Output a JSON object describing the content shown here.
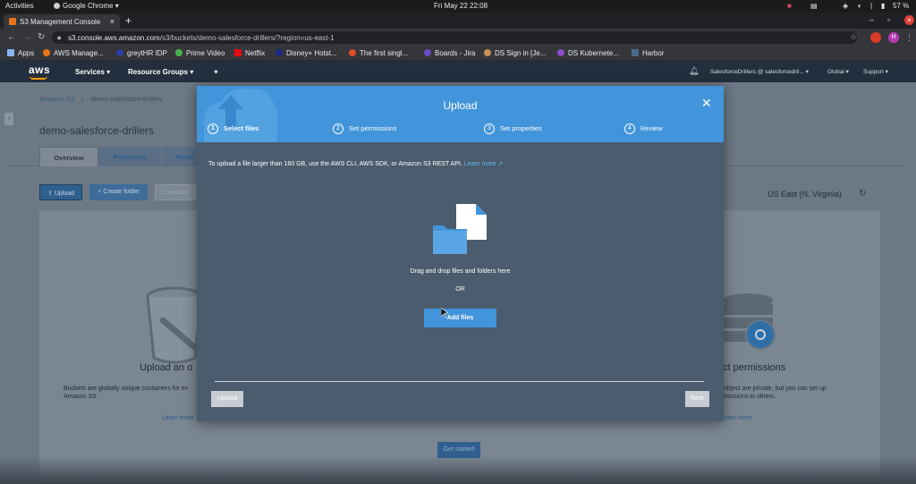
{
  "system_bar": {
    "activities": "Activities",
    "app": "Google Chrome",
    "clock": "Fri May 22  22:08",
    "battery": "57 %"
  },
  "browser": {
    "tab_title": "S3 Management Console",
    "url_domain": "s3.console.aws.amazon.com",
    "url_path": "/s3/buckets/demo-salesforce-drillers/?region=us-east-1",
    "profile_initial": "H",
    "bookmarks": [
      "Apps",
      "AWS Manage...",
      "greytHR IDP",
      "Prime Video",
      "Netflix",
      "Disney+ Hotst...",
      "The first singl...",
      "Boards - Jira",
      "DS Sign in [Je...",
      "DS Kubernete...",
      "Harbor"
    ]
  },
  "aws_header": {
    "logo": "aws",
    "services": "Services",
    "resource_groups": "Resource Groups",
    "account": "SalesforceDrillers @ salesforcedril...",
    "region": "Global",
    "support": "Support"
  },
  "console": {
    "breadcrumb_root": "Amazon S3",
    "breadcrumb_current": "demo-salesforce-drillers",
    "bucket_title": "demo-salesforce-drillers",
    "tabs": [
      "Overview",
      "Properties",
      "Permi"
    ],
    "upload_button": "Upload",
    "create_folder_button": "+ Create folder",
    "download_button": "Download",
    "region_label": "US East (N. Virginia)",
    "left_heading": "Upload an o",
    "left_text_1": "Buckets are globally unique containers for ev",
    "left_text_2": "Amazon S3.",
    "learn_more_left": "Learn more",
    "right_heading": "ct permissions",
    "right_text_1": "object are private, but you can set up",
    "right_text_2": "missions to others.",
    "learn_more_right": "earn more",
    "get_started": "Get started"
  },
  "modal": {
    "title": "Upload",
    "steps": [
      {
        "num": "1",
        "label": "Select files"
      },
      {
        "num": "2",
        "label": "Set permissions"
      },
      {
        "num": "3",
        "label": "Set properties"
      },
      {
        "num": "4",
        "label": "Review"
      }
    ],
    "info_text": "To upload a file larger than 160 GB, use the AWS CLI, AWS SDK, or Amazon S3 REST API.",
    "info_link": "Learn more",
    "drag_text": "Drag and drop files and folders here",
    "or_text": "OR",
    "add_files": "Add files",
    "upload_btn": "Upload",
    "next_btn": "Next"
  },
  "colors": {
    "modal_header": "#4294db",
    "modal_body": "#4a5c6d",
    "aws_nav": "#232f3e",
    "aws_orange": "#ff9900"
  }
}
